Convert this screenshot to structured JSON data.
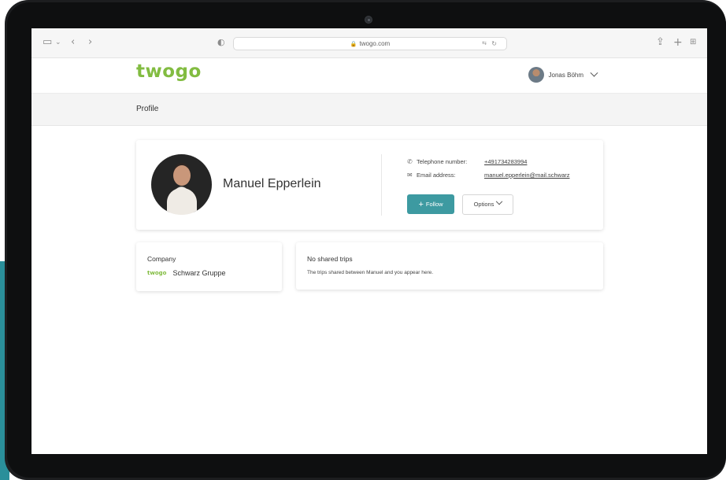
{
  "browser": {
    "url": "twogo.com",
    "icons": {
      "sidebar": "sidebar-icon",
      "back": "back-arrow-icon",
      "forward": "forward-arrow-icon",
      "privacy": "privacy-shield-icon",
      "translate": "translate-icon",
      "reload": "reload-icon",
      "share": "share-icon",
      "new_tab": "plus-icon",
      "tabs": "grid-icon"
    }
  },
  "app": {
    "logo": "twogo",
    "user_name": "Jonas Böhm",
    "page_title": "Profile"
  },
  "profile": {
    "name": "Manuel Epperlein",
    "telephone_label": "Telephone number:",
    "telephone_value": "+491734283994",
    "email_label": "Email address:",
    "email_value": "manuel.epperlein@mail.schwarz",
    "follow_label": "Follow",
    "options_label": "Options"
  },
  "company": {
    "heading": "Company",
    "logo": "twogo",
    "name": "Schwarz Gruppe"
  },
  "trips": {
    "heading": "No shared trips",
    "text": "The trips shared between Manuel and you appear here."
  },
  "colors": {
    "brand_green": "#82bc41",
    "accent_teal": "#3d9aa1"
  }
}
